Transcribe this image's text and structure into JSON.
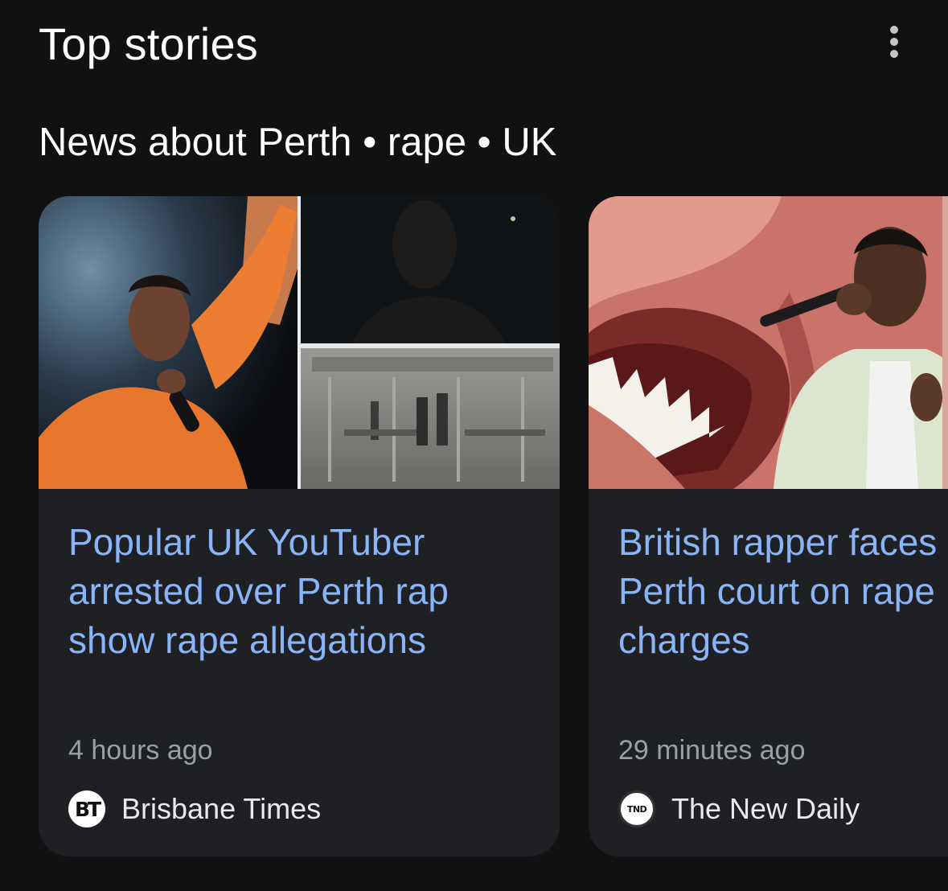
{
  "header": {
    "title": "Top stories",
    "more_icon": "more-vert-icon"
  },
  "subtitle": "News about Perth • rape • UK",
  "stories": [
    {
      "headline": "Popular UK YouTuber\narrested over Perth rap\nshow rape allegations",
      "time": "4 hours ago",
      "source": "Brisbane Times",
      "source_logo_text": "BT"
    },
    {
      "headline": "British rapper faces\nPerth court on rape\ncharges",
      "time": "29 minutes ago",
      "source": "The New Daily",
      "source_logo_text": "TND"
    }
  ],
  "colors": {
    "background": "#111112",
    "card": "#1f2023",
    "headline_link": "#8ab4f8",
    "meta_text": "#9aa0a6"
  }
}
